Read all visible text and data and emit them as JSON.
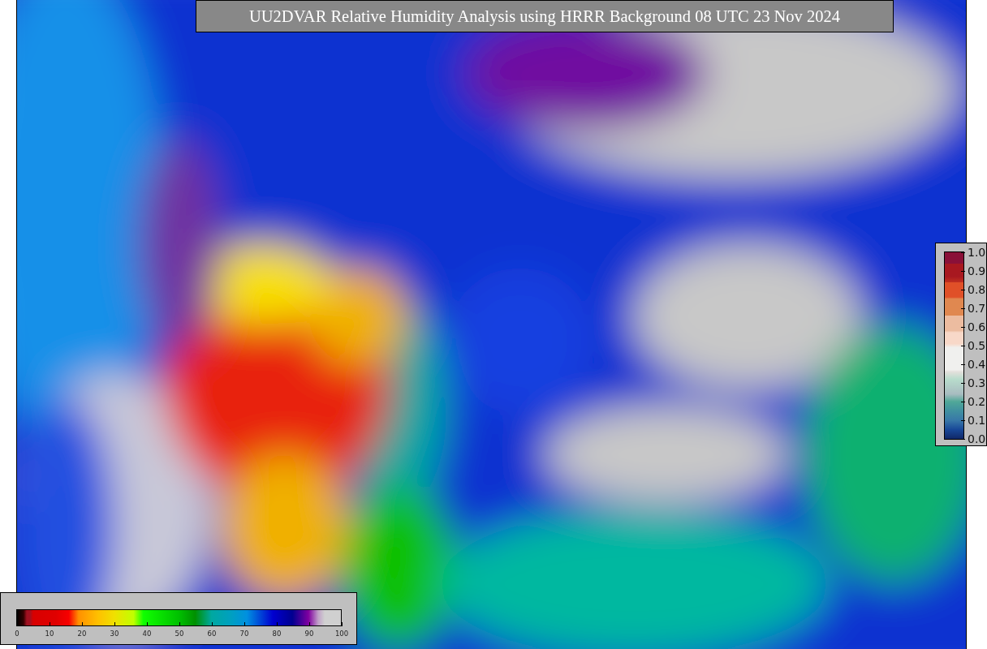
{
  "title": "UU2DVAR Relative Humidity Analysis using HRRR Background 08 UTC 23 Nov 2024",
  "humidity_colorbar": {
    "tick_labels": [
      "0",
      "10",
      "20",
      "30",
      "40",
      "50",
      "60",
      "70",
      "80",
      "90",
      "100"
    ]
  },
  "station_colorbar": {
    "tick_labels": [
      "1.0",
      "0.9",
      "0.8",
      "0.7",
      "0.6",
      "0.5",
      "0.4",
      "0.3",
      "0.2",
      "0.1",
      "0.0"
    ]
  }
}
